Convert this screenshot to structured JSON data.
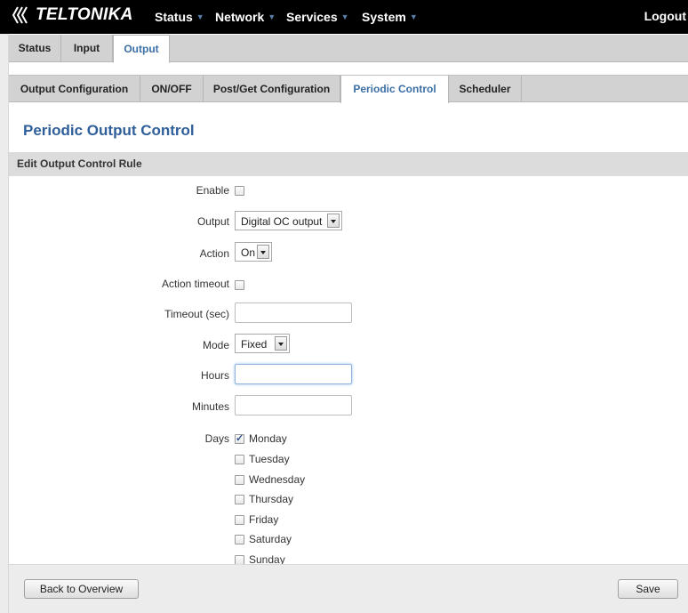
{
  "brand": {
    "name": "TELTONIKA"
  },
  "topnav": {
    "items": [
      {
        "label": "Status"
      },
      {
        "label": "Network"
      },
      {
        "label": "Services"
      },
      {
        "label": "System"
      }
    ],
    "logout": "Logout"
  },
  "tabs_level1": [
    {
      "label": "Status",
      "active": false
    },
    {
      "label": "Input",
      "active": false
    },
    {
      "label": "Output",
      "active": true
    }
  ],
  "tabs_level2": [
    {
      "label": "Output Configuration",
      "active": false
    },
    {
      "label": "ON/OFF",
      "active": false
    },
    {
      "label": "Post/Get Configuration",
      "active": false
    },
    {
      "label": "Periodic Control",
      "active": true
    },
    {
      "label": "Scheduler",
      "active": false
    }
  ],
  "page": {
    "title": "Periodic Output Control",
    "section": "Edit Output Control Rule"
  },
  "form": {
    "enable": {
      "label": "Enable",
      "checked": false
    },
    "output": {
      "label": "Output",
      "value": "Digital OC output"
    },
    "action": {
      "label": "Action",
      "value": "On"
    },
    "action_timeout": {
      "label": "Action timeout",
      "checked": false
    },
    "timeout": {
      "label": "Timeout (sec)",
      "value": ""
    },
    "mode": {
      "label": "Mode",
      "value": "Fixed"
    },
    "hours": {
      "label": "Hours",
      "value": ""
    },
    "minutes": {
      "label": "Minutes",
      "value": ""
    },
    "days": {
      "label": "Days",
      "items": [
        {
          "label": "Monday",
          "checked": true
        },
        {
          "label": "Tuesday",
          "checked": false
        },
        {
          "label": "Wednesday",
          "checked": false
        },
        {
          "label": "Thursday",
          "checked": false
        },
        {
          "label": "Friday",
          "checked": false
        },
        {
          "label": "Saturday",
          "checked": false
        },
        {
          "label": "Sunday",
          "checked": false
        }
      ]
    }
  },
  "footer": {
    "back_label": "Back to Overview",
    "save_label": "Save"
  },
  "colors": {
    "topbar": "#000000",
    "accent": "#2f5f9a",
    "active_tab_text": "#3b6ea5",
    "tab_background": "#d2d2d2"
  }
}
